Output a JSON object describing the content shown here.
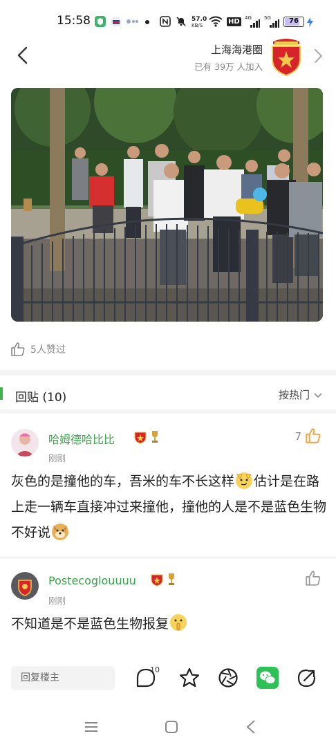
{
  "status_bar": {
    "time": "15:58",
    "speed_value": "57.0",
    "speed_unit": "KB/S",
    "hd_label": "HD",
    "network_1": "4G",
    "network_2": "5G",
    "battery": "76",
    "battery_level": 0.76
  },
  "header": {
    "group_name": "上海海港圈",
    "members": "已有 39万 人加入"
  },
  "post": {
    "likes": "5人赞过"
  },
  "replies": {
    "title": "回贴 (10)",
    "sort_label": "按热门"
  },
  "comments": [
    {
      "name": "哈姆德哈比比",
      "time": "刚刚",
      "like_count": "7",
      "text_1": "灰色的是撞他的车，吾米的车不长这样",
      "text_2": "估计是在路上走一辆车直接冲过来撞他，撞他的人是不是蓝色生物不好说"
    },
    {
      "name": "Postecoglouuuu",
      "time": "刚刚",
      "text": "不知道是不是蓝色生物报复"
    }
  ],
  "bottom_bar": {
    "reply_placeholder": "回复楼主",
    "comment_count": "10"
  },
  "colors": {
    "accent_green": "#3bb54a",
    "brand_red": "#d6242a",
    "like_orange": "#f2a23a"
  }
}
